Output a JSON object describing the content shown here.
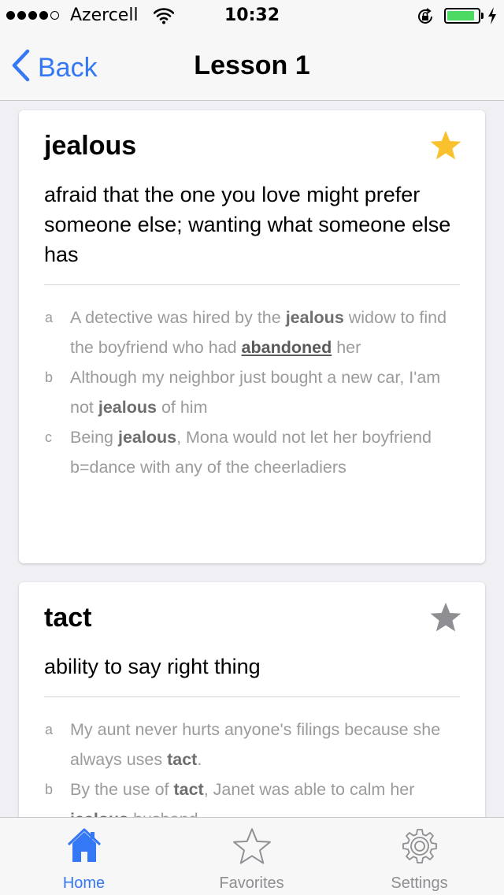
{
  "status_bar": {
    "carrier": "Azercell",
    "time": "10:32",
    "battery_level": 0.9
  },
  "nav": {
    "back_label": "Back",
    "title": "Lesson 1"
  },
  "cards": [
    {
      "word": "jealous",
      "favorite": true,
      "definition": "afraid that the one you love might prefer someone else; wanting what someone else has",
      "examples": [
        {
          "letter": "a",
          "parts": [
            {
              "t": "A detective was hired by the "
            },
            {
              "t": "jealous",
              "s": "b"
            },
            {
              "t": " widow to find the boyfriend who had "
            },
            {
              "t": "abandoned",
              "s": "u"
            },
            {
              "t": " her"
            }
          ]
        },
        {
          "letter": "b",
          "parts": [
            {
              "t": "Although my neighbor just bought a new car, I'am not "
            },
            {
              "t": "jealous",
              "s": "b"
            },
            {
              "t": " of him"
            }
          ]
        },
        {
          "letter": "c",
          "parts": [
            {
              "t": "Being "
            },
            {
              "t": "jealous",
              "s": "b"
            },
            {
              "t": ", Mona would not let her boyfriend b=dance with any of the cheerladiers"
            }
          ]
        }
      ]
    },
    {
      "word": "tact",
      "favorite": false,
      "definition": "ability to say right thing",
      "examples": [
        {
          "letter": "a",
          "parts": [
            {
              "t": "My aunt never hurts anyone's filings because she always uses "
            },
            {
              "t": "tact",
              "s": "b"
            },
            {
              "t": "."
            }
          ]
        },
        {
          "letter": "b",
          "parts": [
            {
              "t": "By the use of "
            },
            {
              "t": "tact",
              "s": "b"
            },
            {
              "t": ", Janet was able to calm her "
            },
            {
              "t": "jealous",
              "s": "b"
            },
            {
              "t": " husband."
            }
          ]
        }
      ]
    }
  ],
  "tabs": [
    {
      "label": "Home",
      "icon": "home-icon",
      "active": true
    },
    {
      "label": "Favorites",
      "icon": "star-outline-icon",
      "active": false
    },
    {
      "label": "Settings",
      "icon": "gear-icon",
      "active": false
    }
  ],
  "colors": {
    "accent": "#3478f6",
    "star_active": "#f8c12d",
    "star_inactive": "#8e8e93",
    "battery": "#4cd964"
  }
}
